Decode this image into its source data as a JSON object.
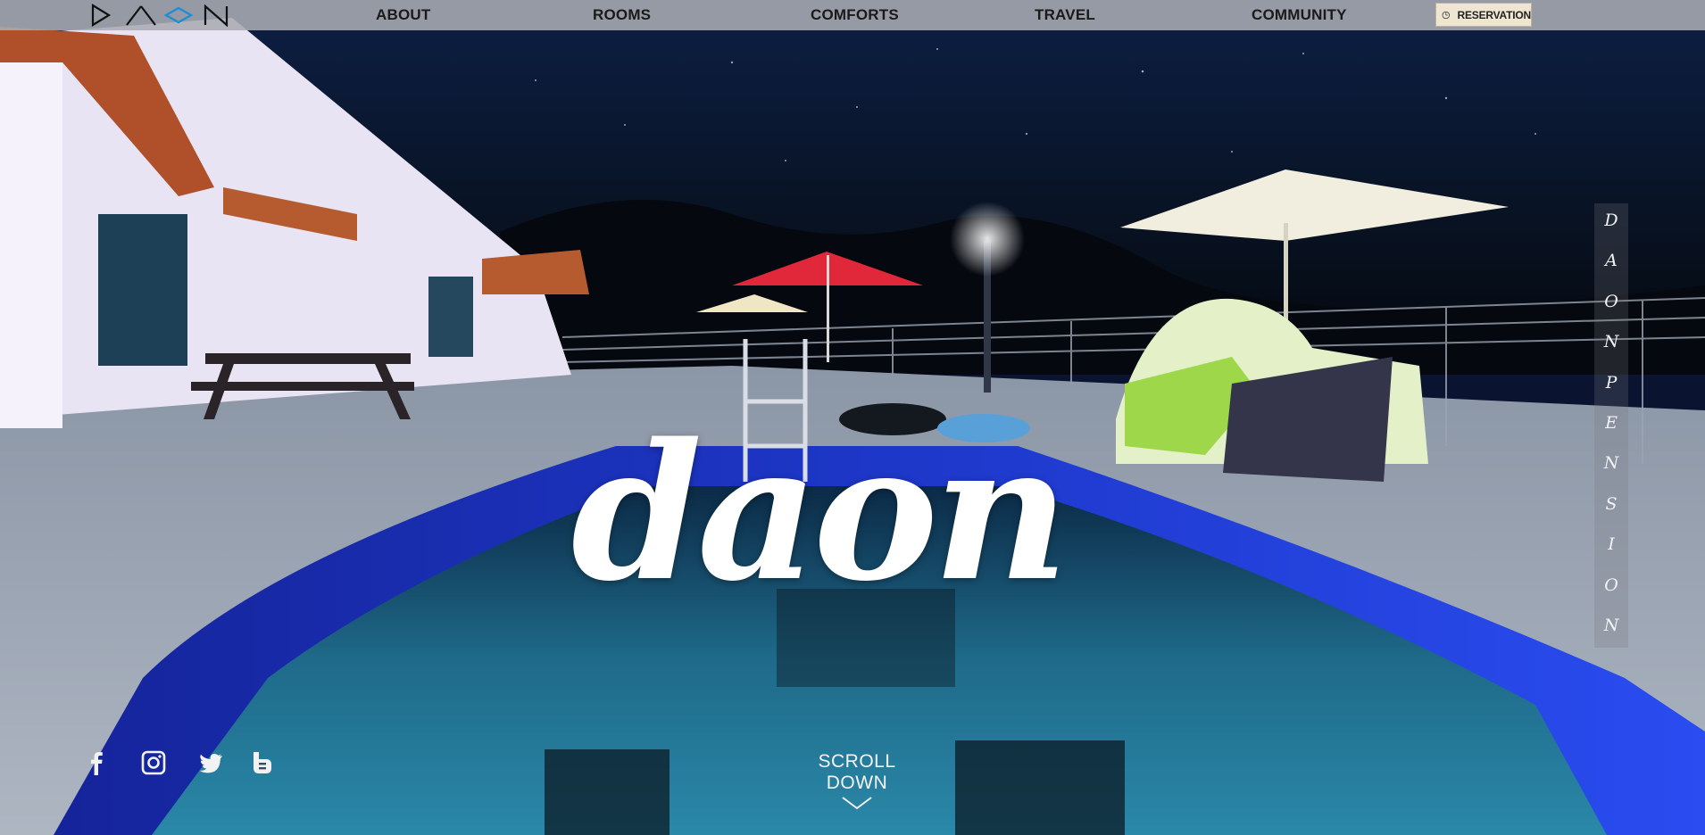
{
  "brand": {
    "logo_text": "DAON"
  },
  "nav": {
    "items": [
      {
        "label": "ABOUT"
      },
      {
        "label": "ROOMS"
      },
      {
        "label": "COMFORTS"
      },
      {
        "label": "TRAVEL"
      },
      {
        "label": "COMMUNITY"
      }
    ],
    "reservation_label": "RESERVATION"
  },
  "hero": {
    "title": "daon",
    "side_letters": [
      "D",
      "A",
      "O",
      "N",
      "P",
      "E",
      "N",
      "S",
      "I",
      "O",
      "N"
    ]
  },
  "social": [
    {
      "icon": "facebook-icon"
    },
    {
      "icon": "instagram-icon"
    },
    {
      "icon": "twitter-icon"
    },
    {
      "icon": "blog-icon"
    }
  ],
  "scroll": {
    "label": "SCROLL DOWN"
  },
  "colors": {
    "nav_bg": "#aaacb2",
    "reservation_bg": "#efe6d2",
    "pool_blue": "#1f3fd8",
    "sky": "#0a1430"
  }
}
